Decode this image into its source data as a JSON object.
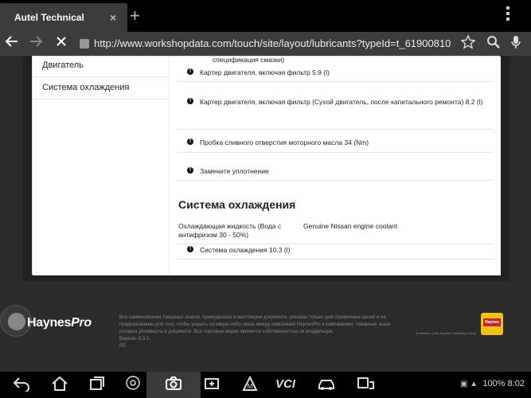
{
  "browser": {
    "tab_title": "Autel Technical",
    "tab_close": "×",
    "new_tab": "+",
    "url": "http://www.workshopdata.com/touch/site/layout/lubricants?typeId=t_61900810",
    "back_icon": "arrow-left-icon",
    "forward_icon": "arrow-right-icon",
    "bookmark_icon": "star-icon",
    "search_icon": "search-icon",
    "menu_icon": "overflow-menu-icon"
  },
  "sidebar": {
    "items": [
      {
        "label": "Двигатель"
      },
      {
        "label": "Система охлаждения"
      }
    ]
  },
  "main": {
    "top_fragment": "спецификация смазки)",
    "rows": [
      {
        "text": "Картер двигателя, включая фильтр 5.9 (l)"
      },
      {
        "text": "Картер двигателя, включая фильтр  (Сухой двигатель, после капитального ремонта) 8.2 (l)"
      },
      {
        "text": "Пробка сливного отверстия моторного масла 34 (Nm)"
      },
      {
        "text": "Замените уплотнение"
      }
    ],
    "section_title": "Система охлаждения",
    "spec_label": "Охлаждающая жидкость (Вода с антифризом 30 - 50%)",
    "spec_value": "Genuine Nissan engine coolant",
    "cooling_row": "Система охлаждения 10.3 (l)"
  },
  "footer": {
    "logo_main": "Haynes",
    "logo_pro": "Pro",
    "disclaimer": "Все наименования товарных знаков, приведенные в настоящем документе, указаны только для справочных целей и не предназначены для того, чтобы указать на какую-либо связь между компанией HaynesPro и компаниями, товарные знаки которых упомянуты в документе. Все торговые марки являются собственностью их владельцев.",
    "version": "Версия- 9.3.1-",
    "r": "R5",
    "member": "A member of the Haynes Publishing Group",
    "badge_text": "Haynes"
  },
  "system": {
    "battery": "100%",
    "time": "8:02"
  },
  "colors": {
    "background": "#2b2b2b",
    "tab_bg": "#3c3c3c",
    "badge_yellow": "#f2c11a",
    "badge_red": "#c8242b"
  }
}
